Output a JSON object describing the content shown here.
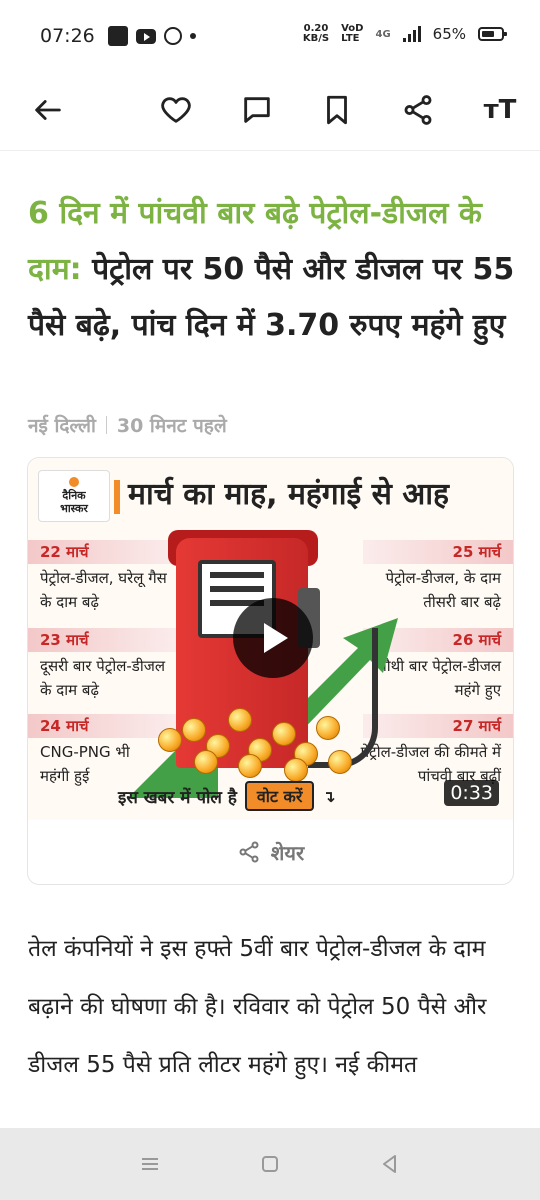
{
  "status_bar": {
    "time": "07:26",
    "net_speed_value": "0.20",
    "net_speed_unit": "KB/S",
    "volte_top": "VoD",
    "volte_bottom": "LTE",
    "network_type": "4G",
    "battery": "65%",
    "app_logo_text": "दैनिक भास्कर"
  },
  "toolbar": {
    "icons": [
      "back-arrow-icon",
      "heart-icon",
      "comment-icon",
      "bookmark-icon",
      "share-icon",
      "text-size-icon"
    ],
    "text_size_label": "ᴛT"
  },
  "article": {
    "headline_prefix": "6 दिन में पांचवी बार बढ़े पेट्रोल-डीजल के दाम:",
    "headline_main": "पेट्रोल पर 50 पैसे और डीजल पर 55 पैसे बढ़े, पांच दिन में 3.70 रुपए महंगे हुए",
    "location": "नई दिल्ली",
    "time_ago": "30 मिनट पहले",
    "body": "तेल कंपनियों ने इस हफ्ते 5वीं बार पेट्रोल-डीजल के दाम बढ़ाने की घोषणा की है। रविवार को पेट्रोल 50 पैसे और डीजल 55 पैसे प्रति लीटर महंगे हुए। नई कीमत"
  },
  "video": {
    "logo_line1": "दैनिक",
    "logo_line2": "भास्कर",
    "title": "मार्च का माह, महंगाई से आह",
    "timeline_left": [
      {
        "date": "22 मार्च",
        "text": "पेट्रोल-डीजल, घरेलू गैस के दाम बढ़े"
      },
      {
        "date": "23 मार्च",
        "text": "दूसरी बार पेट्रोल-डीजल के दाम बढ़े"
      },
      {
        "date": "24 मार्च",
        "text": "CNG-PNG भी महंगी हुई"
      }
    ],
    "timeline_right": [
      {
        "date": "25 मार्च",
        "text": "पेट्रोल-डीजल, के दाम तीसरी बार बढ़े"
      },
      {
        "date": "26 मार्च",
        "text": "चौथी बार पेट्रोल-डीजल महंगे हुए"
      },
      {
        "date": "27 मार्च",
        "text": "पेट्रोल-डीजल की कीमते में पांचवी बार बढ़ीं"
      }
    ],
    "poll_text": "इस खबर में पोल है",
    "vote_button": "वोट करें",
    "poll_arrow": "↴",
    "duration": "0:33",
    "share_label": "शेयर",
    "colors": {
      "accent": "#f28c28",
      "pump_red": "#e53935",
      "arrow_green": "#43a047"
    }
  },
  "nav_bar": {
    "buttons": [
      "menu-icon",
      "home-square-icon",
      "back-triangle-icon"
    ]
  }
}
